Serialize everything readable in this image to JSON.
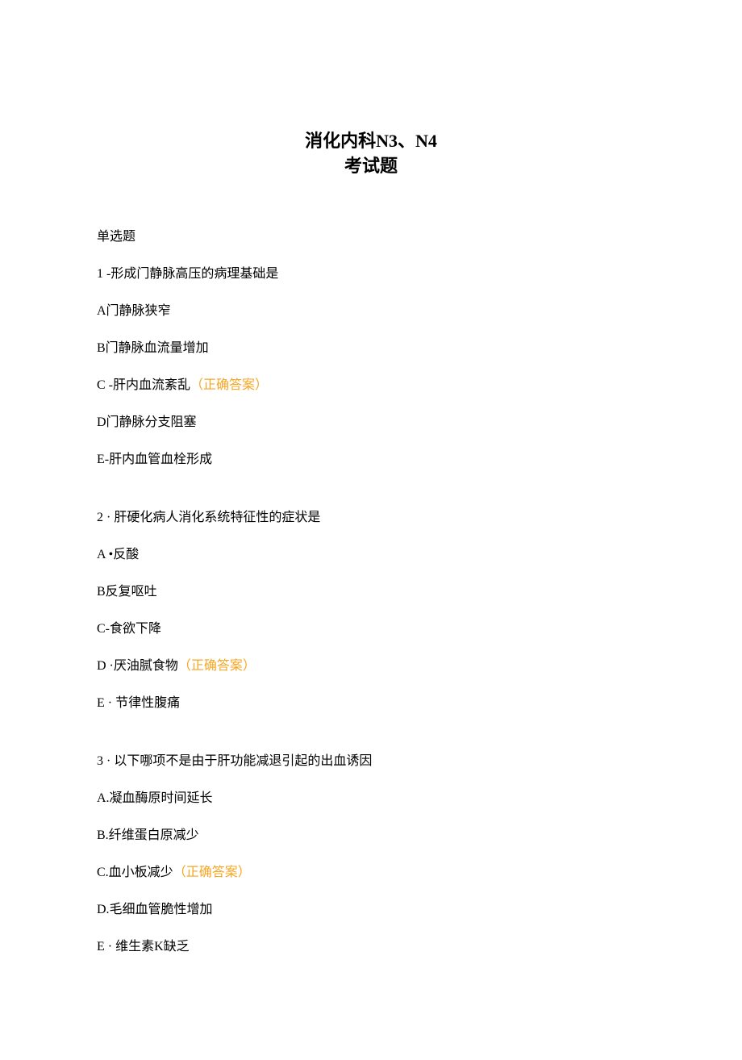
{
  "title": {
    "line1_prefix": "消化内科",
    "line1_bold": "N3、N4",
    "line2": "考试题"
  },
  "section_label": "单选题",
  "correct_label": "（正确答案）",
  "questions": [
    {
      "stem": "1 -形成门静脉高压的病理基础是",
      "options": [
        {
          "text": "A门静脉狭窄",
          "correct": false
        },
        {
          "text": "B门静脉血流量增加",
          "correct": false
        },
        {
          "text": "C -肝内血流紊乱",
          "correct": true
        },
        {
          "text": "D门静脉分支阻塞",
          "correct": false
        },
        {
          "text": "E-肝内血管血栓形成",
          "correct": false
        }
      ]
    },
    {
      "stem": "2 · 肝硬化病人消化系统特征性的症状是",
      "options": [
        {
          "text": "A •反酸",
          "correct": false
        },
        {
          "text": "B反复呕吐",
          "correct": false
        },
        {
          "text": "C-食欲下降",
          "correct": false
        },
        {
          "text": "D ·厌油腻食物",
          "correct": true
        },
        {
          "text": "E · 节律性腹痛",
          "correct": false
        }
      ]
    },
    {
      "stem": "3 · 以下哪项不是由于肝功能减退引起的出血诱因",
      "options": [
        {
          "text": "A.凝血酶原时间延长",
          "correct": false
        },
        {
          "text": "B.纤维蛋白原减少",
          "correct": false
        },
        {
          "text": "C.血小板减少",
          "correct": true
        },
        {
          "text": "D.毛细血管脆性增加",
          "correct": false
        },
        {
          "text": "E · 维生素K缺乏",
          "correct": false
        }
      ]
    }
  ]
}
